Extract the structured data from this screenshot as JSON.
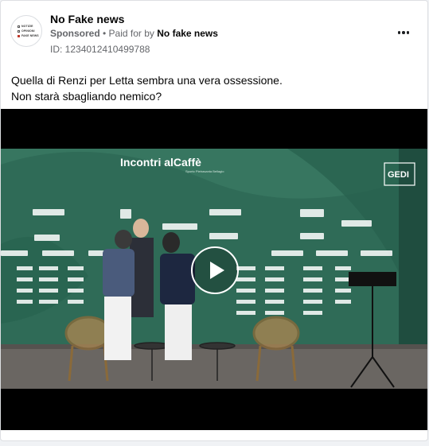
{
  "post": {
    "page_name": "No Fake news",
    "sponsored_label": "Sponsored",
    "separator": " • ",
    "paid_for_label": "Paid for by ",
    "advertiser": "No fake news",
    "ad_id": "ID: 1234012410499788",
    "text_line1": "Quella di Renzi per Letta sembra una vera ossessione.",
    "text_line2": "Non starà sbagliando nemico?",
    "avatar_lines": [
      "NOTIZIE",
      "OPINIONI",
      "FAKE NEWS"
    ]
  },
  "video": {
    "banner_title": "Incontri alCaffè",
    "banner_subtitle": "Sporto Pietrasanta Bellagio",
    "sponsor_logos": [
      "FUTURA",
      "LAVAZZA",
      "Più",
      "Versiliana",
      "RADIO BRUNO",
      "101 tv",
      "Piùme"
    ],
    "overlay_badge": "GEDI"
  },
  "icons": {
    "more": "more-options-icon",
    "play": "play-icon"
  },
  "colors": {
    "backdrop_green": "#2f6b57",
    "stage_floor": "#6a6662",
    "text_secondary": "#65676b"
  }
}
